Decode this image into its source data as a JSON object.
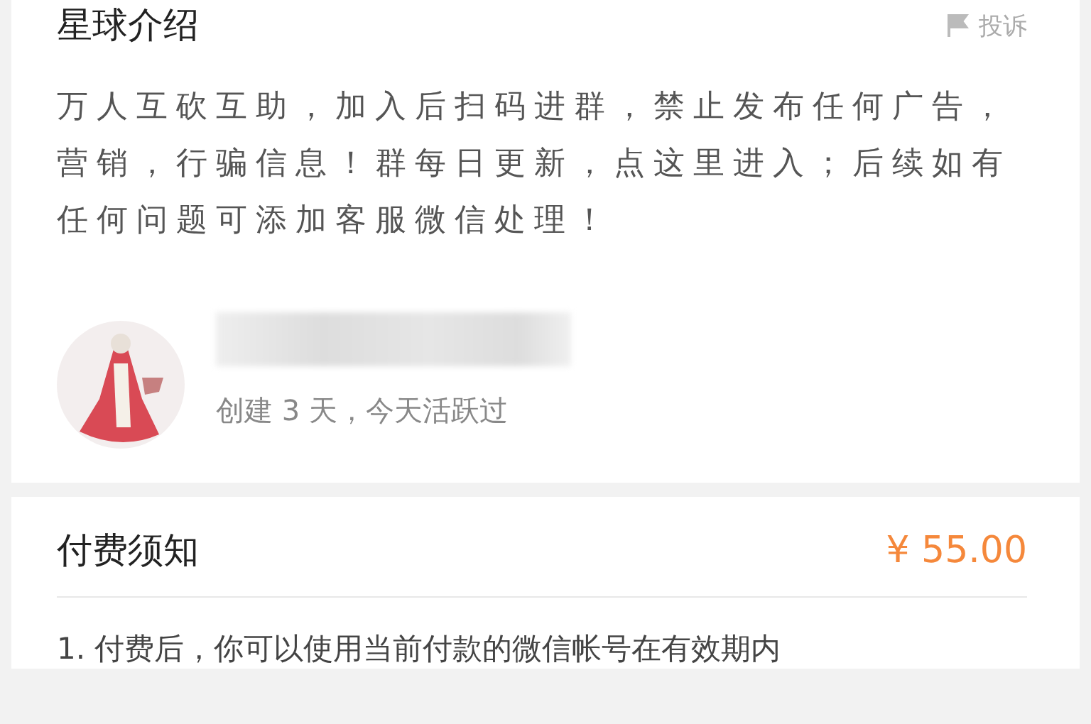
{
  "intro": {
    "title": "星球介绍",
    "report": "投诉",
    "description": "万人互砍互助，加入后扫码进群，禁止发布任何广告，营销，行骗信息！群每日更新，点这里进入；后续如有任何问题可添加客服微信处理！"
  },
  "owner": {
    "activity": "创建 3 天，今天活跃过"
  },
  "payment": {
    "title": "付费须知",
    "price": "¥ 55.00",
    "notes": [
      "1. 付费后，你可以使用当前付款的微信帐号在有效期内"
    ]
  }
}
